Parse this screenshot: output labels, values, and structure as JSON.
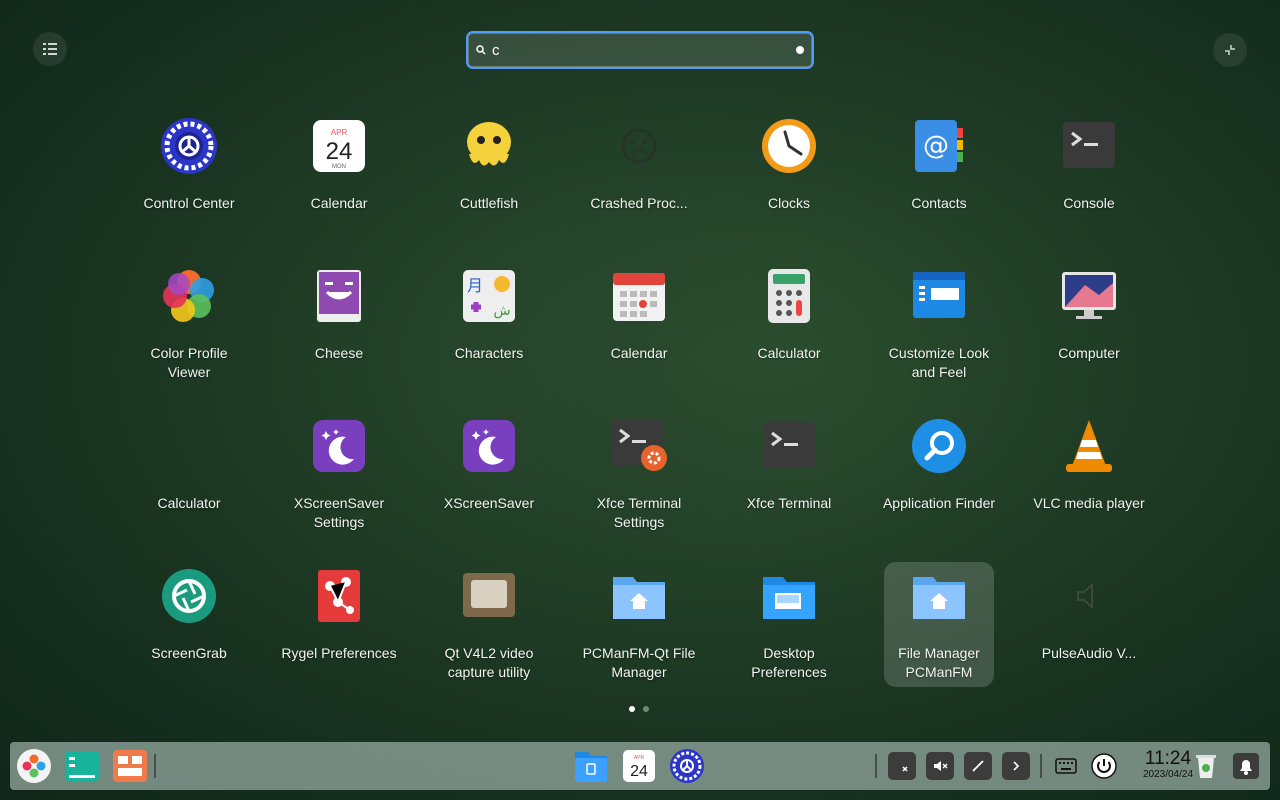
{
  "search": {
    "value": "c"
  },
  "apps": [
    {
      "label": "Control Center"
    },
    {
      "label": "Calendar",
      "month": "APR",
      "day": "24",
      "sub": "MON"
    },
    {
      "label": "Cuttlefish"
    },
    {
      "label": "Crashed Proc..."
    },
    {
      "label": "Clocks"
    },
    {
      "label": "Contacts"
    },
    {
      "label": "Console"
    },
    {
      "label": "Color Profile Viewer"
    },
    {
      "label": "Cheese"
    },
    {
      "label": "Characters",
      "glyphs": [
        "月",
        "ش"
      ]
    },
    {
      "label": "Calendar"
    },
    {
      "label": "Calculator"
    },
    {
      "label": "Customize Look and Feel"
    },
    {
      "label": "Computer"
    },
    {
      "label": "Calculator"
    },
    {
      "label": "XScreenSaver Settings"
    },
    {
      "label": "XScreenSaver"
    },
    {
      "label": "Xfce Terminal Settings"
    },
    {
      "label": "Xfce Terminal"
    },
    {
      "label": "Application Finder"
    },
    {
      "label": "VLC media player"
    },
    {
      "label": "ScreenGrab"
    },
    {
      "label": "Rygel Preferences"
    },
    {
      "label": "Qt V4L2 video capture utility"
    },
    {
      "label": "PCManFM-Qt File Manager"
    },
    {
      "label": "Desktop Preferences"
    },
    {
      "label": "File Manager PCManFM"
    },
    {
      "label": "PulseAudio V..."
    }
  ],
  "dock": {
    "calendar_day": "24",
    "calendar_month": "APR",
    "clock_time": "11:24",
    "clock_date": "2023/04/24"
  }
}
